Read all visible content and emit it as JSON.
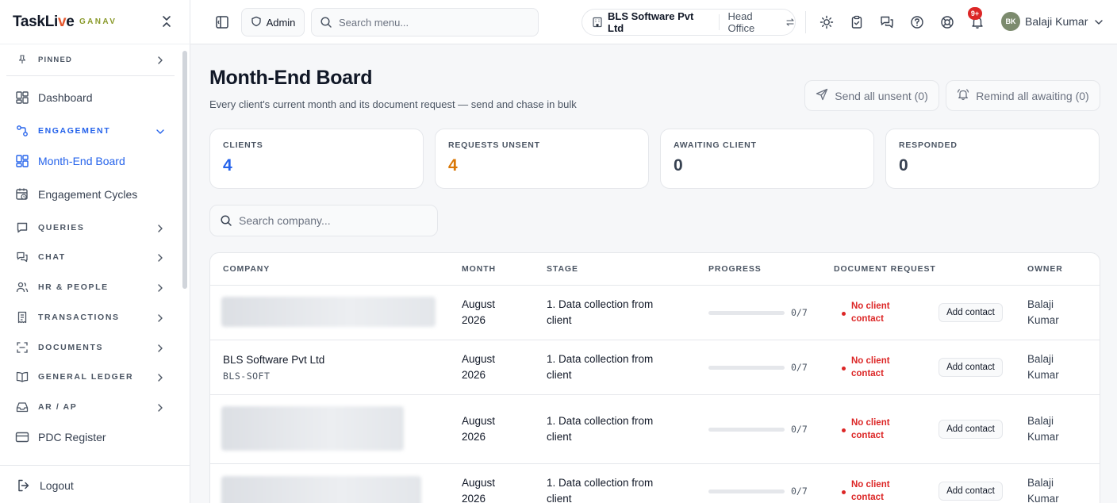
{
  "brand": {
    "logo_prefix": "TaskLi",
    "logo_accent": "v",
    "logo_suffix": "e",
    "sub": "GANAV"
  },
  "sidebar": {
    "pinned": "PINNED",
    "dashboard": "Dashboard",
    "engagement": "ENGAGEMENT",
    "month_end_board": "Month-End Board",
    "engagement_cycles": "Engagement Cycles",
    "queries": "QUERIES",
    "chat": "CHAT",
    "hr_people": "HR & PEOPLE",
    "transactions": "TRANSACTIONS",
    "documents": "DOCUMENTS",
    "general_ledger": "GENERAL LEDGER",
    "ar_ap": "AR / AP",
    "pdc_register": "PDC Register",
    "logout": "Logout"
  },
  "topbar": {
    "role": "Admin",
    "search_placeholder": "Search menu...",
    "company": "BLS Software Pvt Ltd",
    "branch": "Head Office",
    "notifications_badge": "9+",
    "user_initials": "BK",
    "user_name": "Balaji Kumar"
  },
  "page": {
    "title": "Month-End Board",
    "subtitle": "Every client's current month and its document request — send and chase in bulk",
    "send_all": "Send all unsent (0)",
    "remind_all": "Remind all awaiting (0)"
  },
  "stats": [
    {
      "label": "CLIENTS",
      "value": "4",
      "color": "#2563eb"
    },
    {
      "label": "REQUESTS UNSENT",
      "value": "4",
      "color": "#d97706"
    },
    {
      "label": "AWAITING CLIENT",
      "value": "0",
      "color": "#374151"
    },
    {
      "label": "RESPONDED",
      "value": "0",
      "color": "#374151"
    }
  ],
  "company_search_placeholder": "Search company...",
  "table": {
    "headers": [
      "COMPANY",
      "MONTH",
      "STAGE",
      "PROGRESS",
      "DOCUMENT REQUEST",
      "OWNER"
    ],
    "rows": [
      {
        "company": "",
        "code": "",
        "redacted": true,
        "month_1": "August",
        "month_2": "2026",
        "stage_1": "1. Data collection from",
        "stage_2": "client",
        "progress_done": 0,
        "progress_total": 7,
        "progress_text": "0/7",
        "doc_request_1": "No client",
        "doc_request_2": "contact",
        "action": "Add contact",
        "owner_1": "Balaji",
        "owner_2": "Kumar"
      },
      {
        "company": "BLS Software Pvt Ltd",
        "code": "BLS-SOFT",
        "redacted": false,
        "month_1": "August",
        "month_2": "2026",
        "stage_1": "1. Data collection from",
        "stage_2": "client",
        "progress_done": 0,
        "progress_total": 7,
        "progress_text": "0/7",
        "doc_request_1": "No client",
        "doc_request_2": "contact",
        "action": "Add contact",
        "owner_1": "Balaji",
        "owner_2": "Kumar"
      },
      {
        "company": "",
        "code": "",
        "redacted": true,
        "month_1": "August",
        "month_2": "2026",
        "stage_1": "1. Data collection from",
        "stage_2": "client",
        "progress_done": 0,
        "progress_total": 7,
        "progress_text": "0/7",
        "doc_request_1": "No client",
        "doc_request_2": "contact",
        "action": "Add contact",
        "owner_1": "Balaji",
        "owner_2": "Kumar"
      },
      {
        "company": "",
        "code": "",
        "redacted": true,
        "month_1": "August",
        "month_2": "2026",
        "stage_1": "1. Data collection from",
        "stage_2": "client",
        "progress_done": 0,
        "progress_total": 7,
        "progress_text": "0/7",
        "doc_request_1": "No client",
        "doc_request_2": "contact",
        "action": "Add contact",
        "owner_1": "Balaji",
        "owner_2": "Kumar"
      }
    ]
  }
}
